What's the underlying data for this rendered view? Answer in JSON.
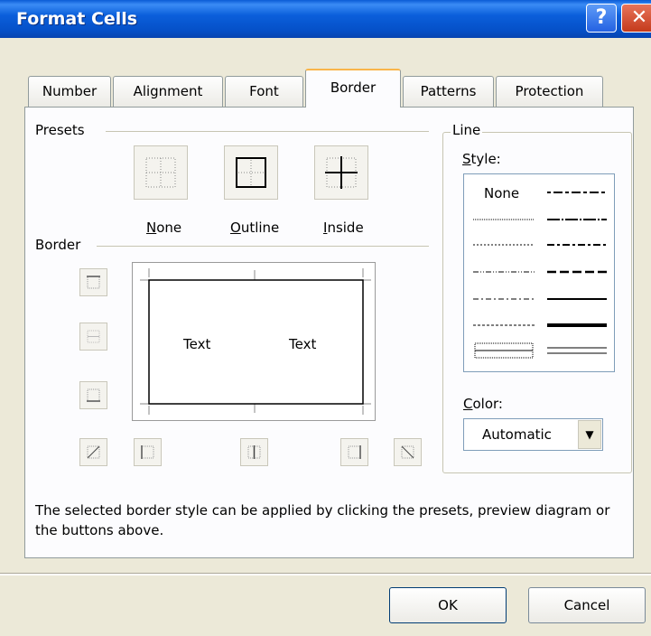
{
  "window": {
    "title": "Format Cells",
    "help_glyph": "?",
    "close_glyph": "✕"
  },
  "tabs": [
    {
      "label": "Number"
    },
    {
      "label": "Alignment"
    },
    {
      "label": "Font"
    },
    {
      "label": "Border",
      "active": true
    },
    {
      "label": "Patterns"
    },
    {
      "label": "Protection"
    }
  ],
  "presets": {
    "section_label": "Presets",
    "items": [
      {
        "label": "None",
        "mnemonic": "N",
        "rest": "one"
      },
      {
        "label": "Outline",
        "mnemonic": "O",
        "rest": "utline"
      },
      {
        "label": "Inside",
        "mnemonic": "I",
        "rest": "nside"
      }
    ]
  },
  "border": {
    "section_label": "Border",
    "preview_texts": [
      "Text",
      "Text"
    ]
  },
  "line": {
    "section_label": "Line",
    "style_label": "Style:",
    "style_mnemonic": "S",
    "style_rest": "tyle:",
    "none_label": "None",
    "color_label": "Color:",
    "color_mnemonic": "C",
    "color_rest": "olor:",
    "color_value": "Automatic",
    "dropdown_glyph": "▼"
  },
  "hint": "The selected border style can be applied by clicking the presets, preview diagram or the buttons above.",
  "buttons": {
    "ok": "OK",
    "cancel": "Cancel"
  },
  "colors": {
    "titlebar": "#0b5fdb",
    "dialog_bg": "#ece9d8",
    "active_tab_accent": "#f9b54a"
  }
}
